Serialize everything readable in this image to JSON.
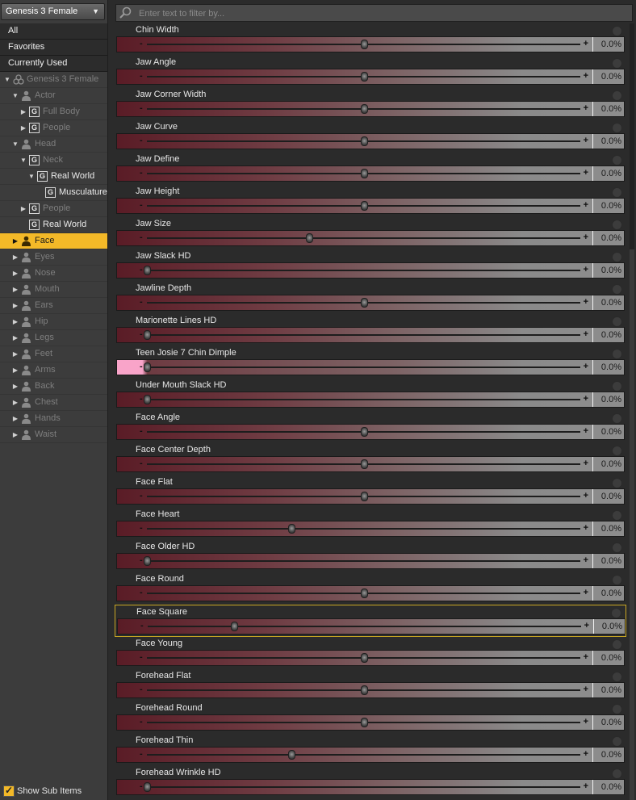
{
  "figure_selector": {
    "label": "Genesis 3 Female"
  },
  "menu": [
    {
      "label": "All"
    },
    {
      "label": "Favorites"
    },
    {
      "label": "Currently Used"
    }
  ],
  "tree": [
    {
      "label": "Genesis 3 Female",
      "depth": 0,
      "icon": "figure",
      "twisty": "down",
      "bright": false
    },
    {
      "label": "Actor",
      "depth": 1,
      "icon": "person",
      "twisty": "down",
      "bright": false
    },
    {
      "label": "Full Body",
      "depth": 2,
      "icon": "group",
      "twisty": "right",
      "bright": false
    },
    {
      "label": "People",
      "depth": 2,
      "icon": "group",
      "twisty": "right",
      "bright": false
    },
    {
      "label": "Head",
      "depth": 1,
      "icon": "person",
      "twisty": "down",
      "bright": false
    },
    {
      "label": "Neck",
      "depth": 2,
      "icon": "group",
      "twisty": "down",
      "bright": false
    },
    {
      "label": "Real World",
      "depth": 3,
      "icon": "group",
      "twisty": "down",
      "bright": true
    },
    {
      "label": "Musculature",
      "depth": 4,
      "icon": "group",
      "twisty": "none",
      "bright": true
    },
    {
      "label": "People",
      "depth": 2,
      "icon": "group",
      "twisty": "right",
      "bright": false
    },
    {
      "label": "Real World",
      "depth": 2,
      "icon": "group",
      "twisty": "none",
      "bright": true
    },
    {
      "label": "Face",
      "depth": 1,
      "icon": "person",
      "twisty": "right",
      "bright": true,
      "selected": true
    },
    {
      "label": "Eyes",
      "depth": 1,
      "icon": "person",
      "twisty": "right",
      "bright": false
    },
    {
      "label": "Nose",
      "depth": 1,
      "icon": "person",
      "twisty": "right",
      "bright": false
    },
    {
      "label": "Mouth",
      "depth": 1,
      "icon": "person",
      "twisty": "right",
      "bright": false
    },
    {
      "label": "Ears",
      "depth": 1,
      "icon": "person",
      "twisty": "right",
      "bright": false
    },
    {
      "label": "Hip",
      "depth": 1,
      "icon": "person",
      "twisty": "right",
      "bright": false
    },
    {
      "label": "Legs",
      "depth": 1,
      "icon": "person",
      "twisty": "right",
      "bright": false
    },
    {
      "label": "Feet",
      "depth": 1,
      "icon": "person",
      "twisty": "right",
      "bright": false
    },
    {
      "label": "Arms",
      "depth": 1,
      "icon": "person",
      "twisty": "right",
      "bright": false
    },
    {
      "label": "Back",
      "depth": 1,
      "icon": "person",
      "twisty": "right",
      "bright": false
    },
    {
      "label": "Chest",
      "depth": 1,
      "icon": "person",
      "twisty": "right",
      "bright": false
    },
    {
      "label": "Hands",
      "depth": 1,
      "icon": "person",
      "twisty": "right",
      "bright": false
    },
    {
      "label": "Waist",
      "depth": 1,
      "icon": "person",
      "twisty": "right",
      "bright": false
    }
  ],
  "show_sub_items": {
    "label": "Show Sub Items",
    "checked": true
  },
  "filter": {
    "placeholder": "Enter text to filter by..."
  },
  "properties": [
    {
      "name": "Chin Width",
      "value": "0.0%",
      "pos": 0.5
    },
    {
      "name": "Jaw Angle",
      "value": "0.0%",
      "pos": 0.5
    },
    {
      "name": "Jaw Corner Width",
      "value": "0.0%",
      "pos": 0.5
    },
    {
      "name": "Jaw Curve",
      "value": "0.0%",
      "pos": 0.5
    },
    {
      "name": "Jaw Define",
      "value": "0.0%",
      "pos": 0.5
    },
    {
      "name": "Jaw Height",
      "value": "0.0%",
      "pos": 0.5
    },
    {
      "name": "Jaw Size",
      "value": "0.0%",
      "pos": 0.375
    },
    {
      "name": "Jaw Slack HD",
      "value": "0.0%",
      "pos": 0.0
    },
    {
      "name": "Jawline Depth",
      "value": "0.0%",
      "pos": 0.5
    },
    {
      "name": "Marionette Lines HD",
      "value": "0.0%",
      "pos": 0.0
    },
    {
      "name": "Teen Josie 7 Chin Dimple",
      "value": "0.0%",
      "pos": 0.0,
      "pink": true
    },
    {
      "name": "Under Mouth Slack HD",
      "value": "0.0%",
      "pos": 0.0
    },
    {
      "name": "Face Angle",
      "value": "0.0%",
      "pos": 0.5
    },
    {
      "name": "Face Center Depth",
      "value": "0.0%",
      "pos": 0.5
    },
    {
      "name": "Face Flat",
      "value": "0.0%",
      "pos": 0.5
    },
    {
      "name": "Face Heart",
      "value": "0.0%",
      "pos": 0.333
    },
    {
      "name": "Face Older HD",
      "value": "0.0%",
      "pos": 0.0
    },
    {
      "name": "Face Round",
      "value": "0.0%",
      "pos": 0.5
    },
    {
      "name": "Face Square",
      "value": "0.0%",
      "pos": 0.2,
      "highlight": true
    },
    {
      "name": "Face Young",
      "value": "0.0%",
      "pos": 0.5
    },
    {
      "name": "Forehead Flat",
      "value": "0.0%",
      "pos": 0.5
    },
    {
      "name": "Forehead Round",
      "value": "0.0%",
      "pos": 0.5
    },
    {
      "name": "Forehead Thin",
      "value": "0.0%",
      "pos": 0.333
    },
    {
      "name": "Forehead Wrinkle HD",
      "value": "0.0%",
      "pos": 0.0
    }
  ],
  "slider_symbols": {
    "minus": "-",
    "plus": "+"
  },
  "colors": {
    "accent": "#f3b928",
    "pink_fill": "#f9a4c9",
    "slider_dark": "#5a1c26"
  }
}
